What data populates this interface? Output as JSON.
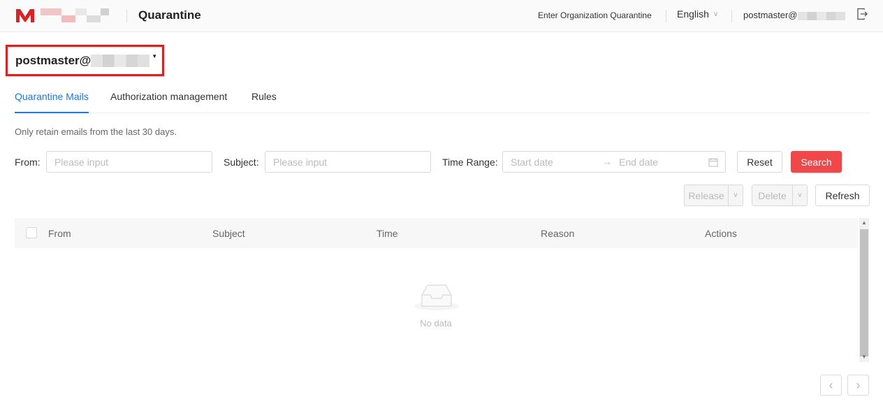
{
  "header": {
    "title": "Quarantine",
    "org_link": "Enter Organization Quarantine",
    "language": "English",
    "user_email": "postmaster@",
    "brand_color": "#e02020"
  },
  "account": {
    "label": "postmaster@"
  },
  "tabs": [
    {
      "label": "Quarantine Mails",
      "active": true
    },
    {
      "label": "Authorization management",
      "active": false
    },
    {
      "label": "Rules",
      "active": false
    }
  ],
  "note": "Only retain emails from the last 30 days.",
  "filters": {
    "from_label": "From",
    "from_placeholder": "Please input",
    "subject_label": "Subject",
    "subject_placeholder": "Please input",
    "time_label": "Time Range",
    "start_placeholder": "Start date",
    "end_placeholder": "End date",
    "reset": "Reset",
    "search": "Search"
  },
  "toolbar": {
    "release": "Release",
    "delete": "Delete",
    "refresh": "Refresh"
  },
  "table": {
    "columns": [
      "From",
      "Subject",
      "Time",
      "Reason",
      "Actions"
    ],
    "rows": [],
    "empty_text": "No data"
  },
  "colors": {
    "primary_button": "#f04848",
    "active_tab": "#1677ff"
  }
}
